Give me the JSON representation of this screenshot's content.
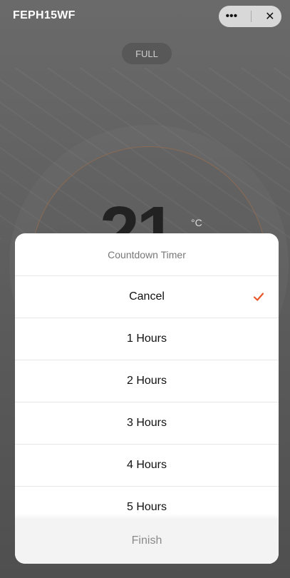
{
  "app": {
    "title": "FEPH15WF",
    "more_icon": "more-icon",
    "close_icon": "close-icon",
    "mode_label": "FULL",
    "temperature": "21",
    "temperature_unit": "°C"
  },
  "sheet": {
    "title": "Countdown Timer",
    "options": [
      {
        "label": "Cancel",
        "selected": true
      },
      {
        "label": "1 Hours",
        "selected": false
      },
      {
        "label": "2 Hours",
        "selected": false
      },
      {
        "label": "3 Hours",
        "selected": false
      },
      {
        "label": "4 Hours",
        "selected": false
      },
      {
        "label": "5 Hours",
        "selected": false
      }
    ],
    "finish_label": "Finish",
    "accent_color": "#e8572a"
  }
}
